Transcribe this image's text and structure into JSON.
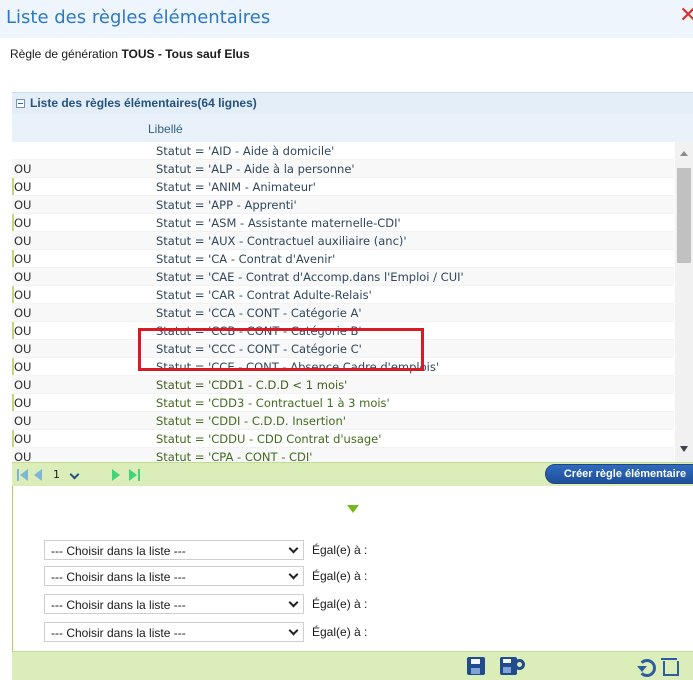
{
  "window": {
    "title": "Liste des règles élémentaires",
    "subtitle_prefix": "Règle de génération",
    "subtitle_value": "TOUS - Tous sauf Elus"
  },
  "panel": {
    "title": "Liste des règles élémentaires(64 lignes)",
    "column": "Libellé"
  },
  "rows": [
    {
      "op": "",
      "rule": "Statut = 'AID - Aide à domicile'"
    },
    {
      "op": "OU",
      "rule": "Statut = 'ALP - Aide à la personne'"
    },
    {
      "op": "OU",
      "rule": "Statut = 'ANIM - Animateur'"
    },
    {
      "op": "OU",
      "rule": "Statut = 'APP - Apprenti'"
    },
    {
      "op": "OU",
      "rule": "Statut = 'ASM - Assistante maternelle-CDI'"
    },
    {
      "op": "OU",
      "rule": "Statut = 'AUX - Contractuel auxiliaire (anc)'"
    },
    {
      "op": "OU",
      "rule": "Statut = 'CA - Contrat d'Avenir'"
    },
    {
      "op": "OU",
      "rule": "Statut = 'CAE - Contrat d'Accomp.dans l'Emploi / CUI'"
    },
    {
      "op": "OU",
      "rule": "Statut = 'CAR - Contrat Adulte-Relais'"
    },
    {
      "op": "OU",
      "rule": "Statut = 'CCA - CONT - Catégorie A'"
    },
    {
      "op": "OU",
      "rule": "Statut = 'CCB - CONT - Catégorie B'"
    },
    {
      "op": "OU",
      "rule": "Statut = 'CCC - CONT - Catégorie C'"
    },
    {
      "op": "OU",
      "rule": "Statut = 'CCE - CONT - Absence Cadre d'emplois'"
    },
    {
      "op": "OU",
      "rule": "Statut = 'CDD1 - C.D.D < 1 mois'"
    },
    {
      "op": "OU",
      "rule": "Statut = 'CDD3 - Contractuel 1 à 3 mois'"
    },
    {
      "op": "OU",
      "rule": "Statut = 'CDDI - C.D.D. Insertion'"
    },
    {
      "op": "OU",
      "rule": "Statut = 'CDDU - CDD Contrat d'usage'"
    },
    {
      "op": "OU",
      "rule": "Statut = 'CPA - CONT - CDI'"
    }
  ],
  "pager": {
    "page": "1",
    "create_button": "Créer règle élémentaire"
  },
  "filters": [
    {
      "field": "--- Choisir dans la liste ---",
      "operator": "Égal(e) à :"
    },
    {
      "field": "--- Choisir dans la liste ---",
      "operator": "Égal(e) à :"
    },
    {
      "field": "--- Choisir dans la liste ---",
      "operator": "Égal(e) à :"
    },
    {
      "field": "--- Choisir dans la liste ---",
      "operator": "Égal(e) à :"
    }
  ],
  "colors": {
    "title": "#2a78c8",
    "header": "#e4eef8",
    "pager": "#dbeeb9",
    "button": "#1f4f99",
    "highlight": "#d51b24"
  },
  "icons": {
    "close": "close-icon",
    "collapse": "collapse-icon",
    "save": "save-icon",
    "save_all": "save-all-icon",
    "refresh": "refresh-icon",
    "trash": "trash-icon"
  }
}
